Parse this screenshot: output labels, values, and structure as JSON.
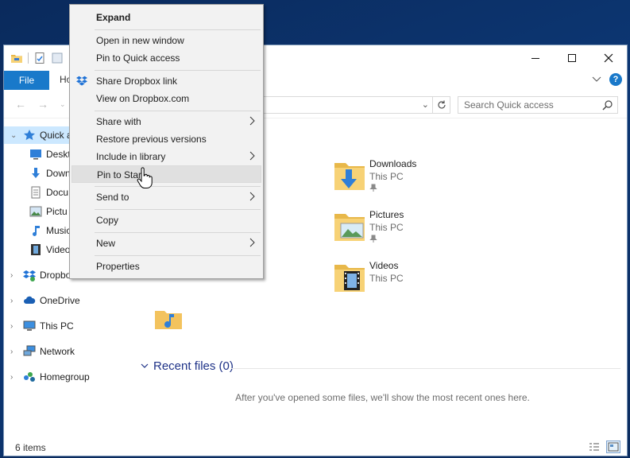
{
  "window": {
    "tabs": {
      "file": "File",
      "home_partial": "Ho"
    }
  },
  "address": {
    "search_placeholder": "Search Quick access"
  },
  "navpane": {
    "items": [
      {
        "label": "Quick a",
        "icon": "star-icon"
      },
      {
        "label": "Deskt",
        "icon": "desktop-icon"
      },
      {
        "label": "Down",
        "icon": "download-arrow-icon"
      },
      {
        "label": "Docu",
        "icon": "document-icon"
      },
      {
        "label": "Pictu",
        "icon": "picture-icon"
      },
      {
        "label": "Music",
        "icon": "music-icon"
      },
      {
        "label": "Video",
        "icon": "film-icon"
      },
      {
        "label": "Dropbo",
        "icon": "dropbox-icon"
      },
      {
        "label": "OneDrive",
        "icon": "cloud-icon"
      },
      {
        "label": "This PC",
        "icon": "computer-icon"
      },
      {
        "label": "Network",
        "icon": "network-icon"
      },
      {
        "label": "Homegroup",
        "icon": "homegroup-icon"
      }
    ]
  },
  "content": {
    "folders": [
      {
        "name": "Downloads",
        "location": "This PC"
      },
      {
        "name": "Pictures",
        "location": "This PC"
      },
      {
        "name": "Videos",
        "location": "This PC"
      }
    ],
    "recent_header": "Recent files (0)",
    "empty_message": "After you've opened some files, we'll show the most recent ones here."
  },
  "status": {
    "items": "6 items"
  },
  "context_menu": {
    "expand": "Expand",
    "open_new_window": "Open in new window",
    "pin_quick_access": "Pin to Quick access",
    "share_dropbox_link": "Share Dropbox link",
    "view_dropbox": "View on Dropbox.com",
    "share_with": "Share with",
    "restore_versions": "Restore previous versions",
    "include_library": "Include in library",
    "pin_start": "Pin to Start",
    "send_to": "Send to",
    "copy": "Copy",
    "new": "New",
    "properties": "Properties"
  },
  "colors": {
    "accent": "#1979ca",
    "selection": "#cce8ff",
    "desktop": "#0d3774",
    "menu_bg": "#f2f2f2",
    "recent_header": "#1e3287"
  }
}
